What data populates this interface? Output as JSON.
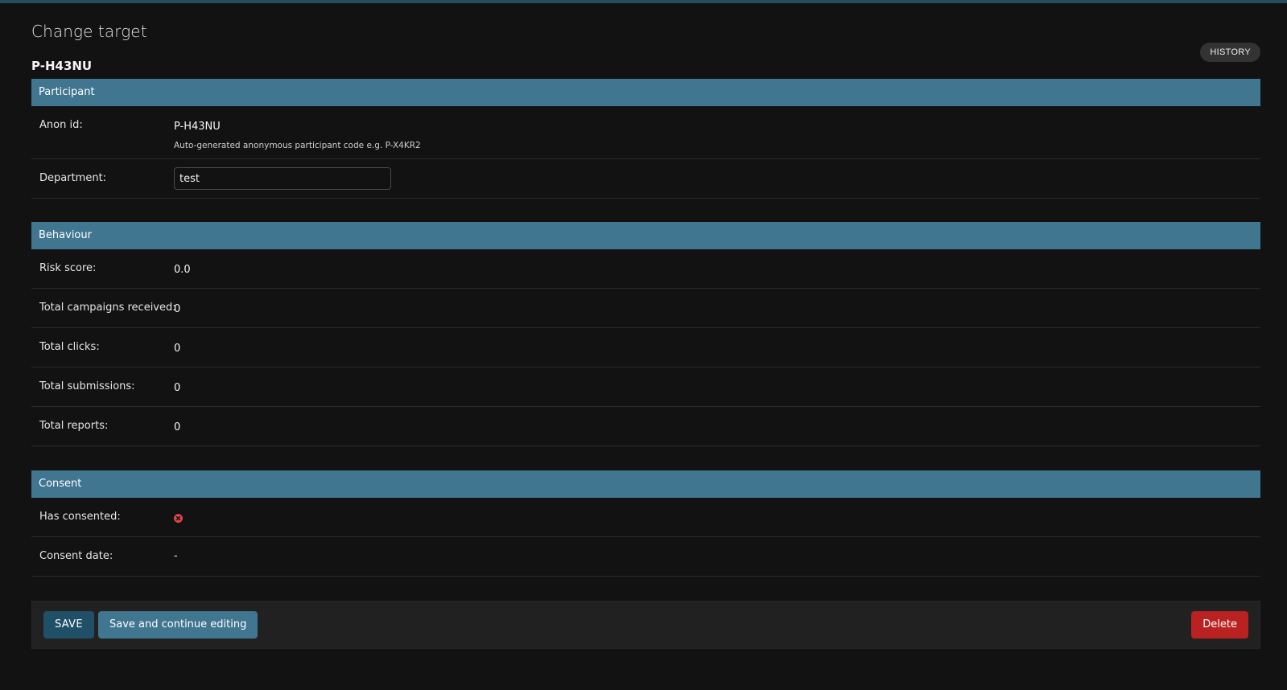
{
  "page": {
    "title": "Change target",
    "object_title": "P-H43NU",
    "history_label": "HISTORY"
  },
  "participant": {
    "header": "Participant",
    "anon_id_label": "Anon id:",
    "anon_id_value": "P-H43NU",
    "anon_id_help": "Auto-generated anonymous participant code e.g. P-X4KR2",
    "department_label": "Department:",
    "department_value": "test"
  },
  "behaviour": {
    "header": "Behaviour",
    "rows": [
      {
        "label": "Risk score:",
        "value": "0.0"
      },
      {
        "label": "Total campaigns received:",
        "value": "0"
      },
      {
        "label": "Total clicks:",
        "value": "0"
      },
      {
        "label": "Total submissions:",
        "value": "0"
      },
      {
        "label": "Total reports:",
        "value": "0"
      }
    ]
  },
  "consent": {
    "header": "Consent",
    "has_consented_label": "Has consented:",
    "has_consented_icon": "false-icon",
    "consent_date_label": "Consent date:",
    "consent_date_value": "-"
  },
  "actions": {
    "save_label": "SAVE",
    "save_continue_label": "Save and continue editing",
    "delete_label": "Delete"
  },
  "colors": {
    "header_bg": "#417690",
    "save_bg": "#205067",
    "delete_bg": "#ba2121",
    "false_icon": "#dd4646"
  }
}
